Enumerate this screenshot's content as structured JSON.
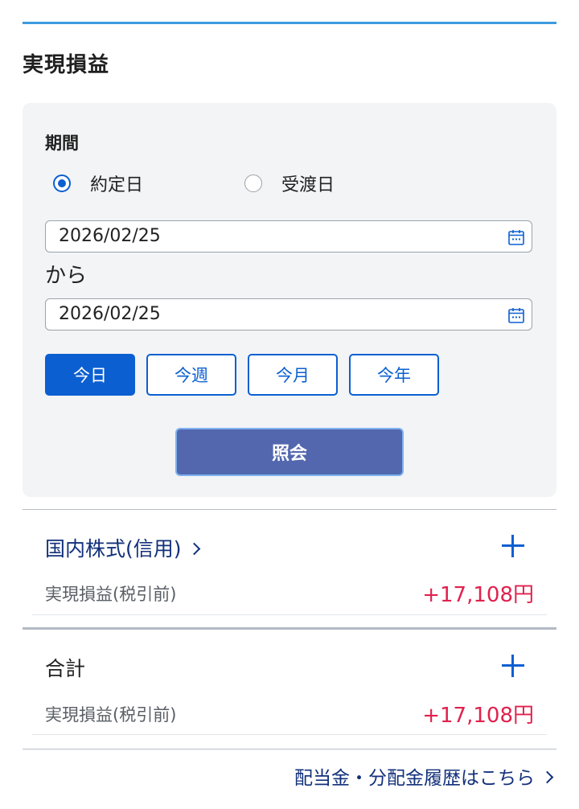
{
  "header": {
    "title": "実現損益"
  },
  "filter": {
    "period_label": "期間",
    "date_basis": {
      "options": [
        "約定日",
        "受渡日"
      ],
      "selected": "約定日"
    },
    "from_date": "2026/02/25",
    "separator": "から",
    "to_date": "2026/02/25",
    "quick_ranges": [
      "今日",
      "今週",
      "今月",
      "今年"
    ],
    "active_quick_range": "今日",
    "submit_label": "照会"
  },
  "sections": [
    {
      "title": "国内株式(信用)",
      "is_link": true,
      "row_label": "実現損益(税引前)",
      "row_value": "+17,108円"
    },
    {
      "title": "合計",
      "is_link": false,
      "row_label": "実現損益(税引前)",
      "row_value": "+17,108円"
    }
  ],
  "footer": {
    "link_label": "配当金・分配金履歴はこちら"
  },
  "colors": {
    "accent": "#0b5fd1",
    "submit": "#5267ae",
    "positive": "#e0224e",
    "link": "#12307a"
  }
}
